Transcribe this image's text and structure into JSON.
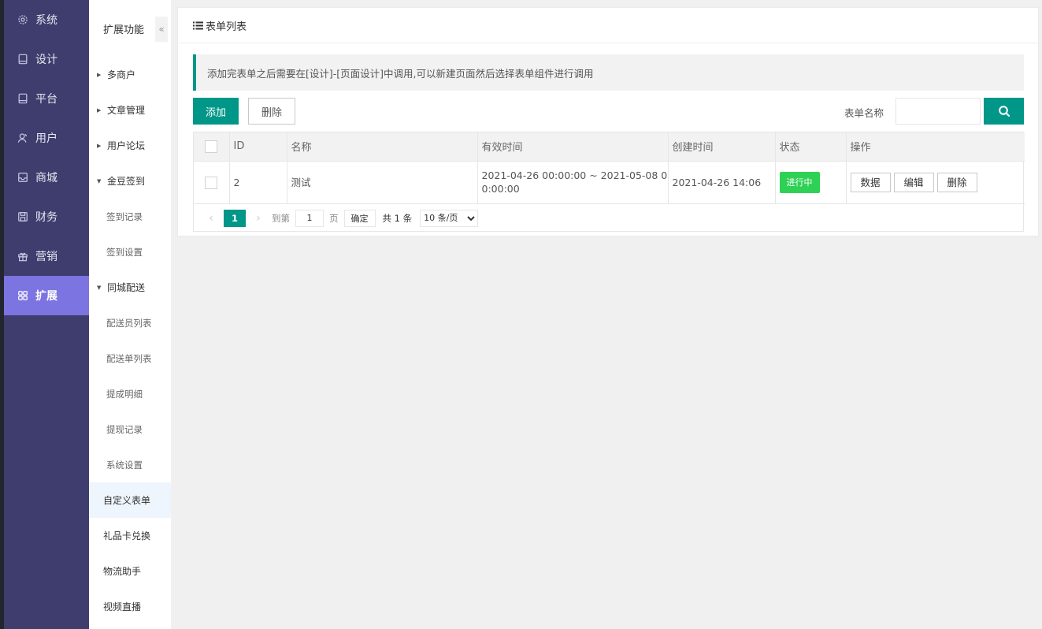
{
  "sidebar": {
    "items": [
      {
        "label": "系统",
        "icon": "gear-icon"
      },
      {
        "label": "设计",
        "icon": "tablet-icon"
      },
      {
        "label": "平台",
        "icon": "tablet-icon"
      },
      {
        "label": "用户",
        "icon": "user-icon"
      },
      {
        "label": "商城",
        "icon": "inbox-icon"
      },
      {
        "label": "财务",
        "icon": "save-icon"
      },
      {
        "label": "营销",
        "icon": "gift-icon"
      },
      {
        "label": "扩展",
        "icon": "apps-icon"
      }
    ],
    "active_index": 7
  },
  "subnav": {
    "title": "扩展功能",
    "collapse_glyph": "«",
    "items": [
      {
        "label": "多商户",
        "type": "group",
        "expanded": false
      },
      {
        "label": "文章管理",
        "type": "group",
        "expanded": false
      },
      {
        "label": "用户论坛",
        "type": "group",
        "expanded": false
      },
      {
        "label": "金豆签到",
        "type": "group",
        "expanded": true
      },
      {
        "label": "签到记录",
        "type": "sub"
      },
      {
        "label": "签到设置",
        "type": "sub"
      },
      {
        "label": "同城配送",
        "type": "group",
        "expanded": true
      },
      {
        "label": "配送员列表",
        "type": "sub"
      },
      {
        "label": "配送单列表",
        "type": "sub"
      },
      {
        "label": "提成明细",
        "type": "sub"
      },
      {
        "label": "提现记录",
        "type": "sub"
      },
      {
        "label": "系统设置",
        "type": "sub"
      },
      {
        "label": "自定义表单",
        "type": "plain",
        "current": true
      },
      {
        "label": "礼品卡兑换",
        "type": "plain"
      },
      {
        "label": "物流助手",
        "type": "plain"
      },
      {
        "label": "视频直播",
        "type": "plain"
      }
    ]
  },
  "panel": {
    "title": "表单列表",
    "notice": "添加完表单之后需要在[设计]-[页面设计]中调用,可以新建页面然后选择表单组件进行调用",
    "add_label": "添加",
    "delete_label": "删除",
    "search_label": "表单名称",
    "search_value": ""
  },
  "table": {
    "columns": [
      "ID",
      "名称",
      "有效时间",
      "创建时间",
      "状态",
      "操作"
    ],
    "rows": [
      {
        "id": "2",
        "name": "测试",
        "valid_time": "2021-04-26 00:00:00 ~ 2021-05-08 00:00:00",
        "created": "2021-04-26 14:06",
        "status": "进行中",
        "actions": [
          "数据",
          "编辑",
          "删除"
        ]
      }
    ]
  },
  "pager": {
    "prev_glyph": "‹",
    "next_glyph": "›",
    "current_page": "1",
    "goto_label": "到第",
    "goto_value": "1",
    "page_unit": "页",
    "confirm_label": "确定",
    "total_text": "共 1 条",
    "page_size": "10 条/页"
  },
  "colors": {
    "sidebar_bg": "#3f3d6e",
    "sidebar_active": "#7c74e0",
    "primary": "#009688",
    "status_green": "#2ed155"
  }
}
